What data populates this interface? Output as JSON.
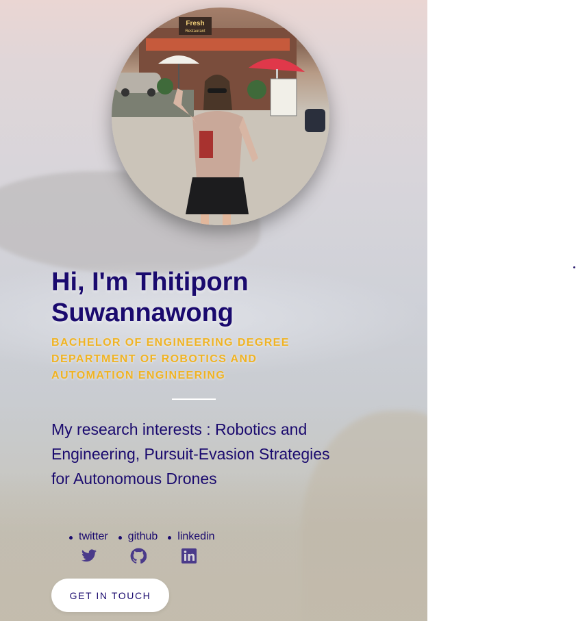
{
  "hero": {
    "title": "Hi, I'm Thitiporn Suwannawong",
    "subtitle_lines": [
      "BACHELOR OF ENGINEERING DEGREE",
      "DEPARTMENT OF ROBOTICS AND",
      "AUTOMATION ENGINEERING"
    ],
    "research": "My research interests : Robotics and Engineering, Pursuit-Evasion Strategies for Autonomous Drones",
    "photo_signs": [
      "Fresh",
      "Restaurant"
    ]
  },
  "social": {
    "links": [
      {
        "label": "twitter",
        "icon": "twitter-icon"
      },
      {
        "label": "github",
        "icon": "github-icon"
      },
      {
        "label": "linkedin",
        "icon": "linkedin-icon"
      }
    ]
  },
  "cta": {
    "label": "GET IN TOUCH"
  },
  "colors": {
    "text": "#1a0a6e",
    "accent": "#f0b323",
    "icon": "#4a3a8a",
    "panel": "#d8d5da"
  }
}
